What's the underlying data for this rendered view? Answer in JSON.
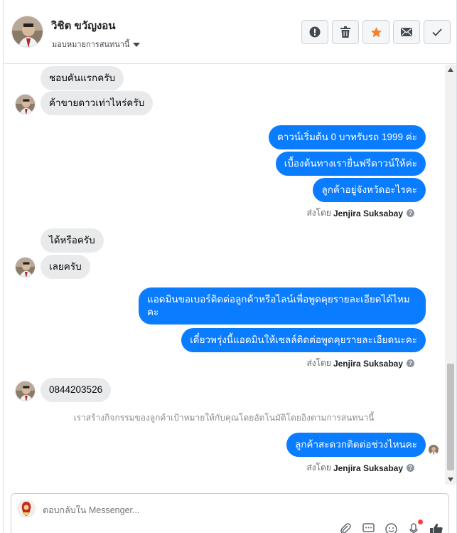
{
  "header": {
    "contact_name": "วิชิต ขวัญงอน",
    "assign_label": "มอบหมายการสนทนานี้",
    "actions": [
      "report-icon",
      "trash-icon",
      "star-icon",
      "mail-icon",
      "check-icon"
    ]
  },
  "messages": {
    "m1": "ชอบคันแรกครับ",
    "m2": "ค้าขายดาวเท่าไหร่ครับ",
    "m3": "ดาวน์เริ่มต้น 0 บาทรับรถ 1999 ค่ะ",
    "m4": "เบื้องต้นทางเรายื่นฟรีดาวน์ให้ค่ะ",
    "m5": "ลูกค้าอยู่จังหวัดอะไรคะ",
    "m6": "ได้หรือครับ",
    "m7": "เลยครับ",
    "m8": "แอดมินขอเบอร์ติดต่อลูกค้าหรือไลน์เพื่อพูดคุยรายละเอียดได้ไหมคะ",
    "m9": "เดี๋ยวพรุ่งนี้แอดมินให้เซลล์ติดต่อพูดคุยรายละเอียดนะคะ",
    "m10": "0844203526",
    "m11": "ลูกค้าสะดวกติดต่อช่วงไหนคะ"
  },
  "sentby": {
    "prefix": "ส่งโดย",
    "agent": "Jenjira Suksabay"
  },
  "system_note": "เราสร้างกิจกรรมของลูกค้าเป้าหมายให้กับคุณโดยอัตโนมัติโดยอิงตามการสนทนานี้",
  "composer": {
    "placeholder": "ตอบกลับใน Messenger...",
    "tools": [
      "attachment-icon",
      "saved-replies-icon",
      "emoji-icon",
      "audio-icon",
      "like-icon"
    ]
  },
  "colors": {
    "outgoing_bubble": "#0a7cff",
    "incoming_bubble": "#e9eaeb",
    "star": "#f5822a"
  }
}
